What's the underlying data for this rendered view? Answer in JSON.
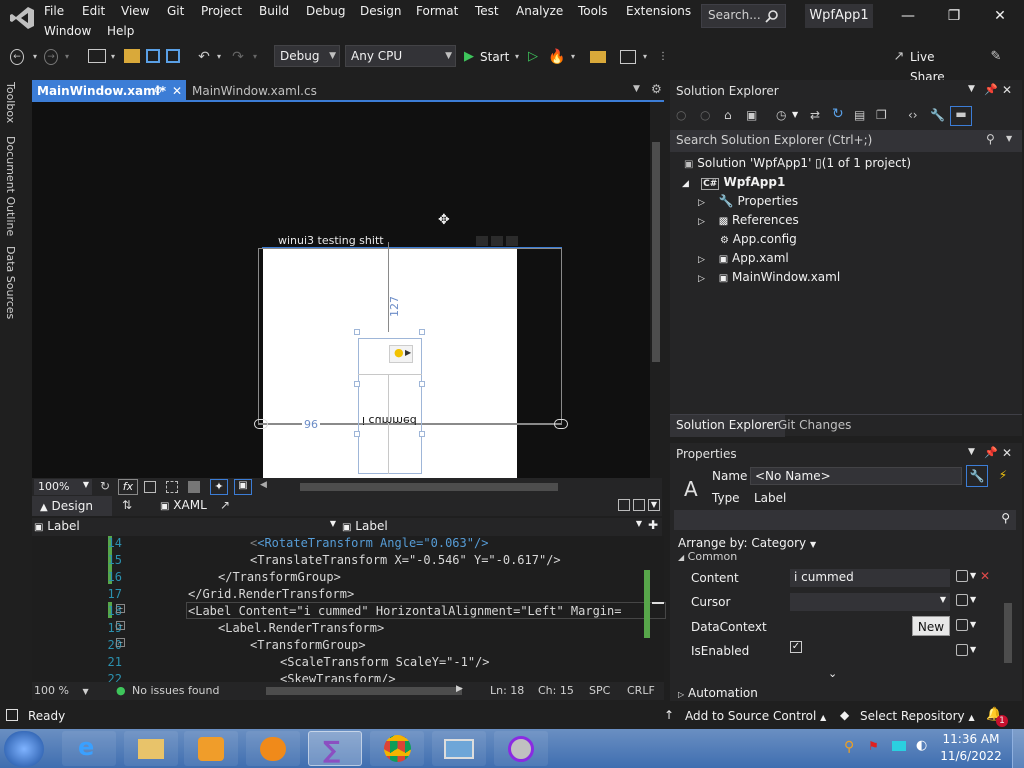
{
  "menu": {
    "items": [
      "File",
      "Edit",
      "View",
      "Git",
      "Project",
      "Build",
      "Debug",
      "Design",
      "Format",
      "Test",
      "Analyze",
      "Tools",
      "Extensions",
      "Window",
      "Help"
    ],
    "search": "Search...",
    "app_badge": "WpfApp1"
  },
  "toolbar": {
    "config": "Debug",
    "platform": "Any CPU",
    "start": "Start",
    "live_share": "Live Share"
  },
  "left_tabs": [
    "Toolbox",
    "Document Outline",
    "Data Sources"
  ],
  "doc_tabs": [
    {
      "label": "MainWindow.xaml*",
      "active": true
    },
    {
      "label": "MainWindow.xaml.cs",
      "active": false
    }
  ],
  "designer": {
    "window_title": "winui3 testing shitt",
    "label_text": "i cummed",
    "measure_top": "127",
    "measure_left": "96"
  },
  "zoom": {
    "value": "100%",
    "fx": "fx"
  },
  "split": {
    "design": "Design",
    "xaml": "XAML"
  },
  "selector": {
    "left": "Label",
    "right": "Label"
  },
  "code": {
    "lines": [
      {
        "n": "14",
        "text": "<RotateTransform Angle=\"0.063\"/>"
      },
      {
        "n": "15",
        "text": "<TranslateTransform X=\"-0.546\" Y=\"-0.617\"/>"
      },
      {
        "n": "16",
        "text": "</TransformGroup>"
      },
      {
        "n": "17",
        "text": "</Grid.RenderTransform>"
      },
      {
        "n": "18",
        "text": "<Label Content=\"i cummed\" HorizontalAlignment=\"Left\" Margin="
      },
      {
        "n": "19",
        "text": "<Label.RenderTransform>"
      },
      {
        "n": "20",
        "text": "<TransformGroup>"
      },
      {
        "n": "21",
        "text": "<ScaleTransform ScaleY=\"-1\"/>"
      },
      {
        "n": "22",
        "text": "<SkewTransform/>"
      }
    ]
  },
  "code_status": {
    "zoom": "100 %",
    "issues": "No issues found",
    "ln": "Ln: 18",
    "ch": "Ch: 15",
    "spc": "SPC",
    "crlf": "CRLF"
  },
  "solution_explorer": {
    "title": "Solution Explorer",
    "search": "Search Solution Explorer (Ctrl+;)",
    "solution": "Solution 'WpfApp1' ▯(1 of 1 project)",
    "project": "WpfApp1",
    "items": [
      "Properties",
      "References",
      "App.config",
      "App.xaml",
      "MainWindow.xaml"
    ],
    "bottom_tabs": [
      "Solution Explorer",
      "Git Changes"
    ]
  },
  "properties": {
    "title": "Properties",
    "name_label": "Name",
    "name_value": "<No Name>",
    "type_label": "Type",
    "type_value": "Label",
    "arrange": "Arrange by: Category",
    "section": "Common",
    "rows": [
      {
        "label": "Content",
        "value": "i cummed"
      },
      {
        "label": "Cursor",
        "value": ""
      },
      {
        "label": "DataContext",
        "value": ""
      },
      {
        "label": "IsEnabled",
        "value": ""
      }
    ],
    "new_button": "New",
    "automation": "Automation"
  },
  "statusbar": {
    "ready": "Ready",
    "source_control": "Add to Source Control",
    "repo": "Select Repository",
    "notif_count": "1"
  },
  "taskbar": {
    "time": "11:36 AM",
    "date": "11/6/2022"
  },
  "colors": {
    "accent": "#3c7dd6",
    "vs_purple": "#68217a",
    "status_bg": "#1f1f1f"
  }
}
